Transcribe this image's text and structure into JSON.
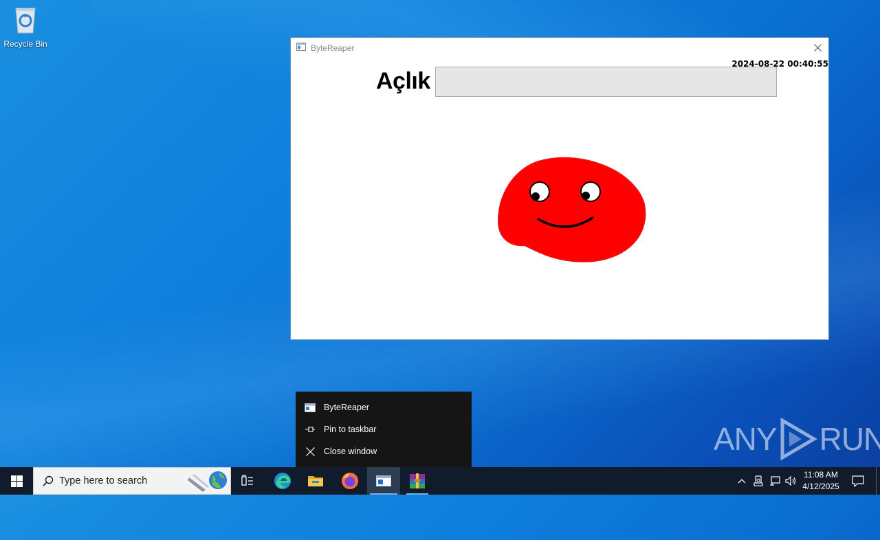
{
  "desktop": {
    "recycle_bin_label": "Recycle Bin"
  },
  "window": {
    "title": "ByteReaper",
    "timestamp": "2024-08-22 00:40:55",
    "hunger_label": "Açlık",
    "hunger_level_percent": 0
  },
  "jumplist": {
    "items": [
      {
        "label": "ByteReaper",
        "icon": "app-window-icon"
      },
      {
        "label": "Pin to taskbar",
        "icon": "pin-icon"
      },
      {
        "label": "Close window",
        "icon": "close-icon"
      }
    ]
  },
  "watermark": {
    "left": "ANY",
    "right": "RUN"
  },
  "taskbar": {
    "search_placeholder": "Type here to search",
    "clock_time": "11:08 AM",
    "clock_date": "4/12/2025"
  },
  "colors": {
    "pet_body": "#ff0000",
    "taskbar_bg": "#101c2c",
    "jumplist_bg": "#151515"
  }
}
